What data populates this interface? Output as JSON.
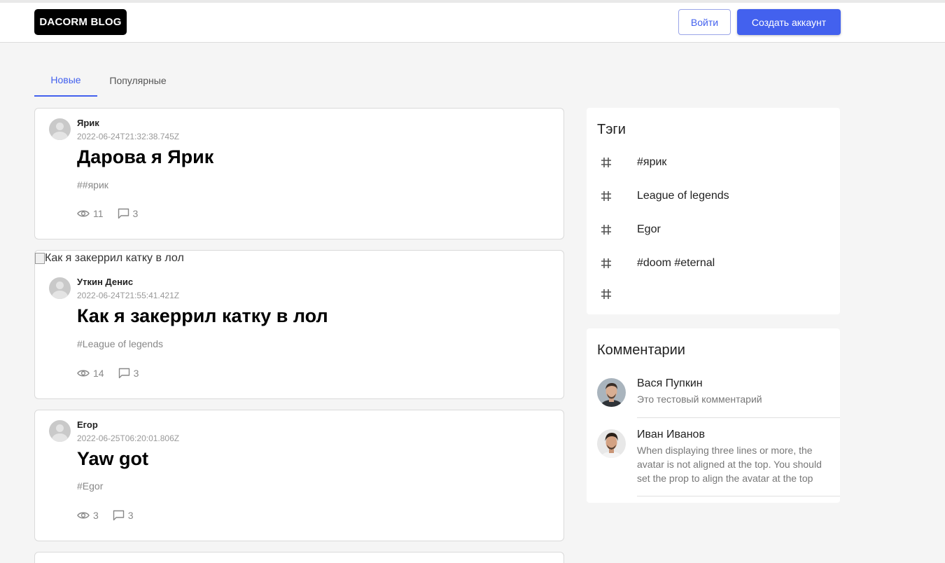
{
  "header": {
    "logo": "DACORM BLOG",
    "login_label": "Войти",
    "signup_label": "Создать аккаунт"
  },
  "tabs": [
    {
      "label": "Новые",
      "active": true
    },
    {
      "label": "Популярные",
      "active": false
    }
  ],
  "posts": [
    {
      "author": "Ярик",
      "date": "2022-06-24T21:32:38.745Z",
      "title": "Дарова я Ярик",
      "tags": "##ярик",
      "views": "11",
      "comments": "3"
    },
    {
      "image_alt": "Как я закеррил катку в лол",
      "author": "Уткин Денис",
      "date": "2022-06-24T21:55:41.421Z",
      "title": "Как я закеррил катку в лол",
      "tags": "#League of legends",
      "views": "14",
      "comments": "3"
    },
    {
      "author": "Егор",
      "date": "2022-06-25T06:20:01.806Z",
      "title": "Yaw got",
      "tags": "#Egor",
      "views": "3",
      "comments": "3"
    }
  ],
  "tags_panel": {
    "title": "Тэги",
    "items": [
      "#ярик",
      "League of legends",
      "Egor",
      "#doom #eternal",
      ""
    ]
  },
  "comments_panel": {
    "title": "Комментарии",
    "items": [
      {
        "name": "Вася Пупкин",
        "text": "Это тестовый комментарий"
      },
      {
        "name": "Иван Иванов",
        "text": "When displaying three lines or more, the avatar is not aligned at the top. You should set the prop to align the avatar at the top"
      }
    ]
  },
  "colors": {
    "accent": "#4361ee",
    "background": "#f5f5f5",
    "logo_bg": "#000000"
  }
}
